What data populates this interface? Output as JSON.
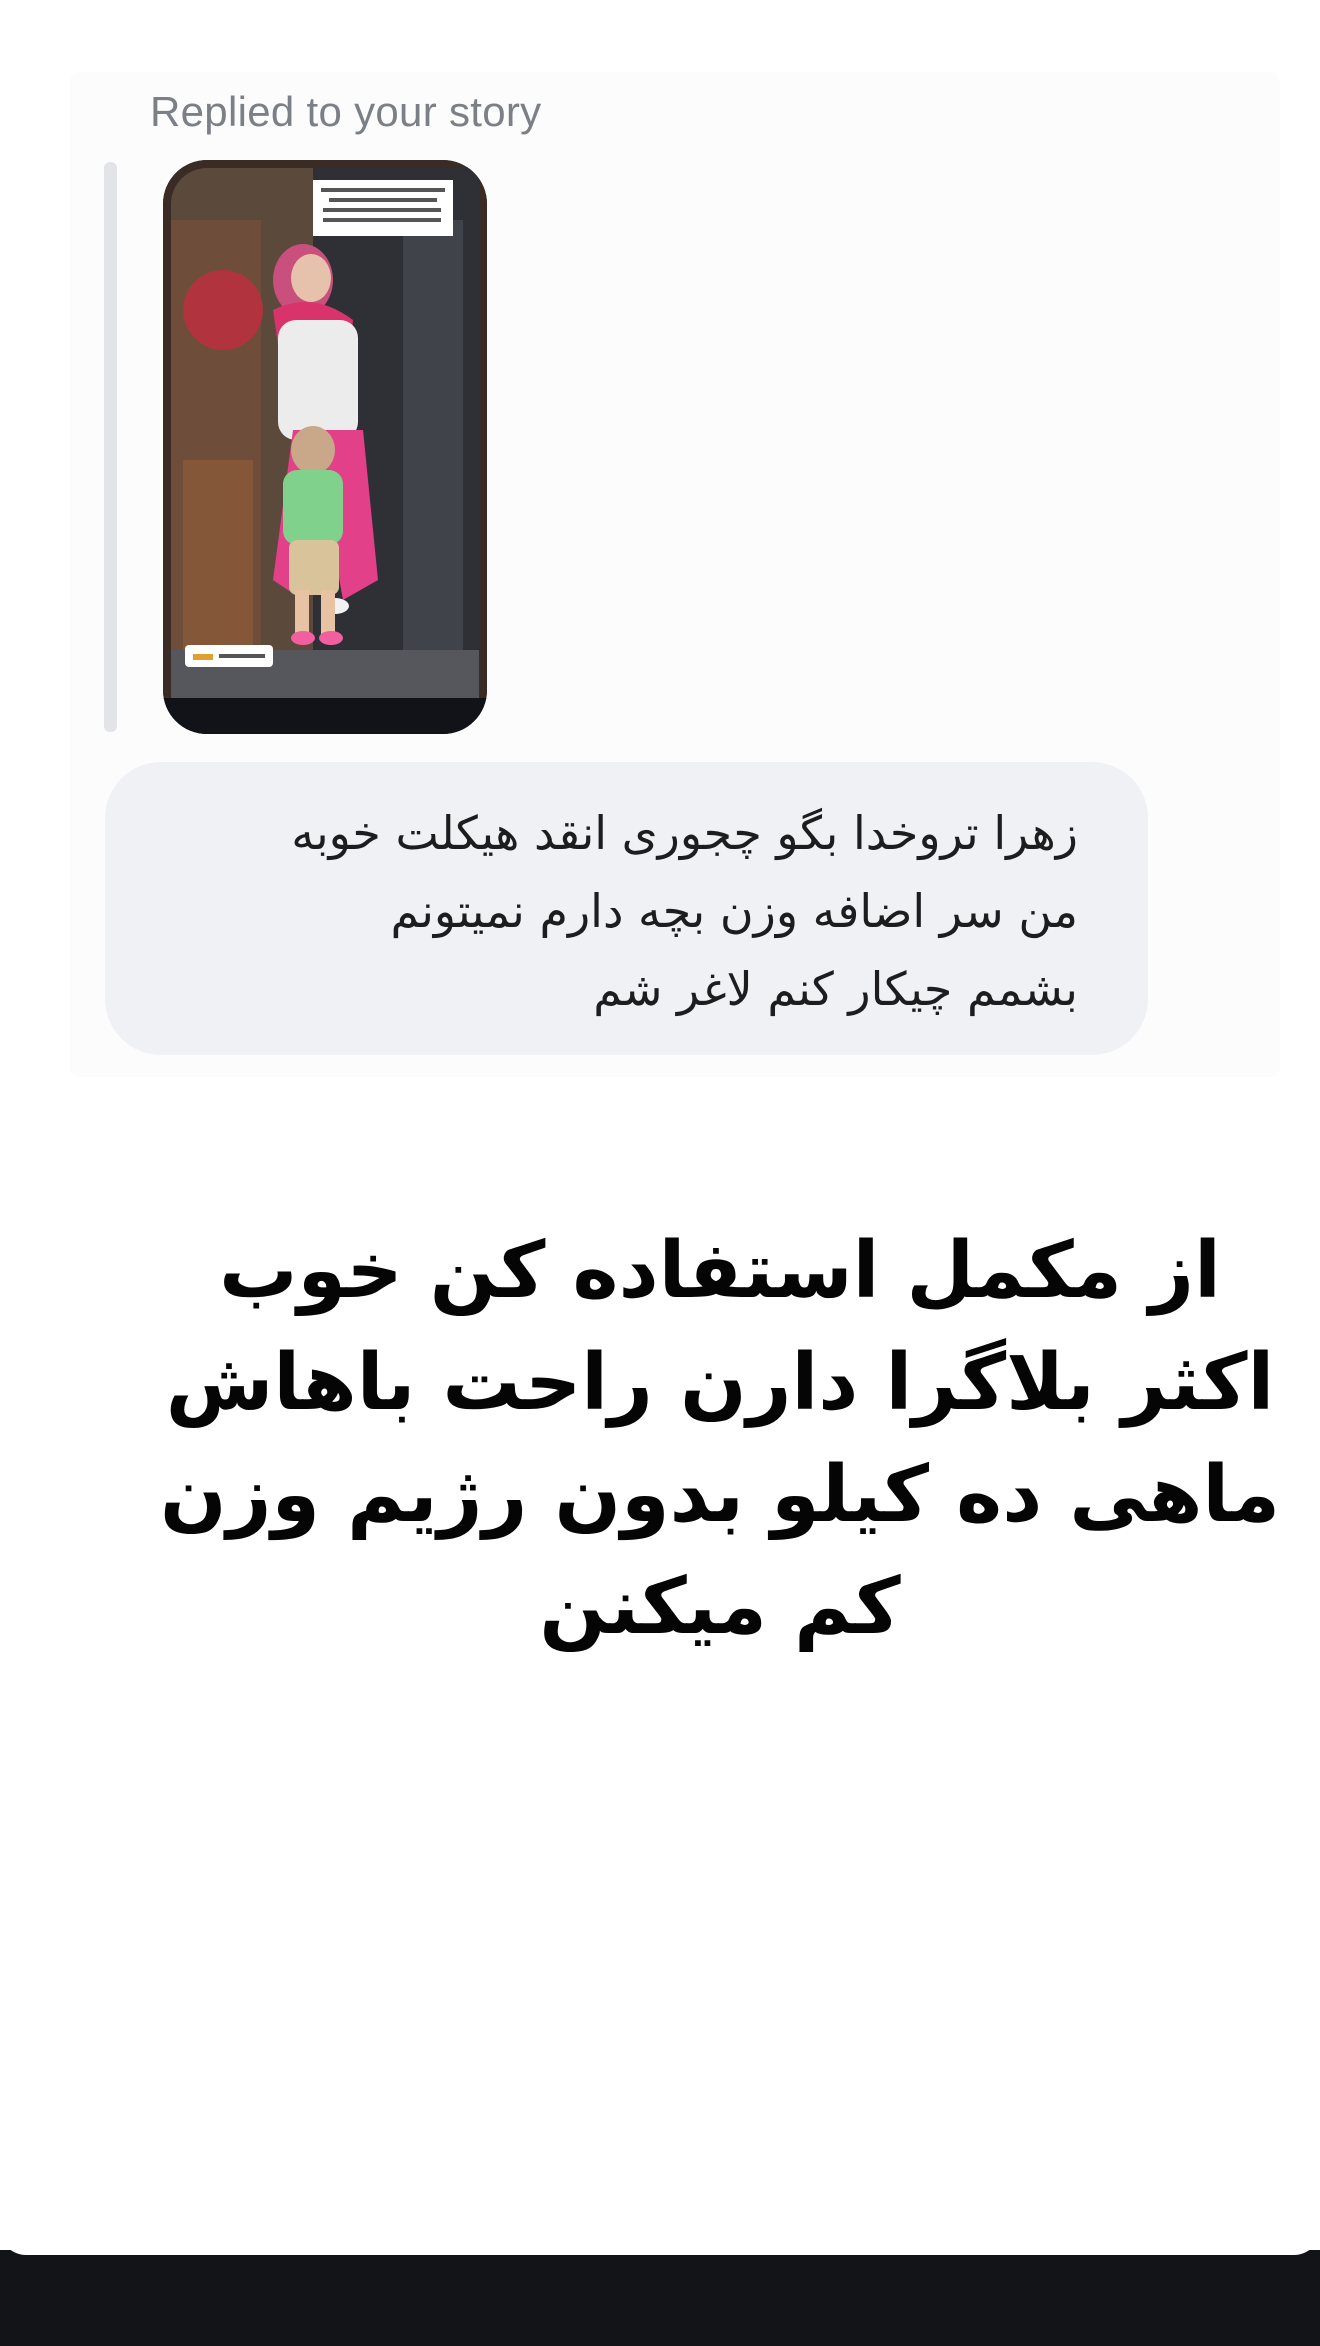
{
  "reply_header": {
    "label": "Replied to your story"
  },
  "story_thumbnail": {
    "caption_lines": [
      "گاهی یاد می گیرن ...",
      "انقدر دور ..."
    ],
    "bottom_tag": "با دخترم"
  },
  "message": {
    "lines": [
      "زهرا تروخدا بگو چجوری انقد هیکلت خوبه",
      "من سر اضافه وزن بچه دارم نمیتونم",
      "بشمم چیکار کنم لاغر شم"
    ]
  },
  "story_overlay": {
    "lines": [
      "از مکمل استفاده کن خوب",
      "اکثر بلاگرا دارن راحت باهاش",
      "ماهی ده کیلو بدون رژیم وزن",
      "کم میکنن"
    ]
  },
  "colors": {
    "bubble": "#f0f1f4",
    "label_gray": "#7b7f86",
    "bottom_bar": "#121418"
  }
}
